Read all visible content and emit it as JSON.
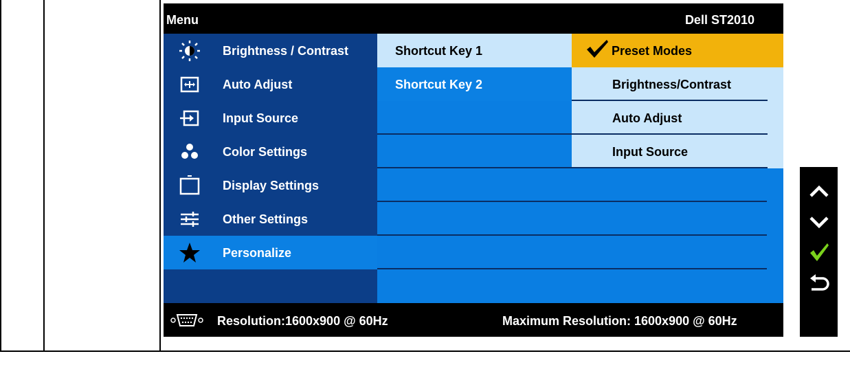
{
  "osd": {
    "title": "Menu",
    "model": "Dell ST2010",
    "menu_items": [
      {
        "label": "Brightness / Contrast",
        "icon": "brightness-icon"
      },
      {
        "label": "Auto Adjust",
        "icon": "auto-adjust-icon"
      },
      {
        "label": "Input Source",
        "icon": "input-source-icon"
      },
      {
        "label": "Color Settings",
        "icon": "color-settings-icon"
      },
      {
        "label": "Display Settings",
        "icon": "display-settings-icon"
      },
      {
        "label": "Other Settings",
        "icon": "other-settings-icon"
      },
      {
        "label": "Personalize",
        "icon": "star-icon"
      }
    ],
    "submenu1": [
      "Shortcut Key 1",
      "Shortcut Key 2"
    ],
    "submenu2": [
      "Preset Modes",
      "Brightness/Contrast",
      "Auto Adjust",
      "Input Source"
    ],
    "status": {
      "resolution": "Resolution:1600x900 @ 60Hz",
      "max_resolution": "Maximum Resolution: 1600x900 @ 60Hz"
    }
  },
  "colors": {
    "dark_blue": "#0c3e88",
    "bright_blue": "#0a7ee2",
    "light_blue": "#c9e6fb",
    "highlight": "#f2b20b",
    "check_green": "#7bd21c"
  },
  "side_buttons": [
    "up-arrow-icon",
    "down-arrow-icon",
    "check-icon",
    "back-icon"
  ]
}
